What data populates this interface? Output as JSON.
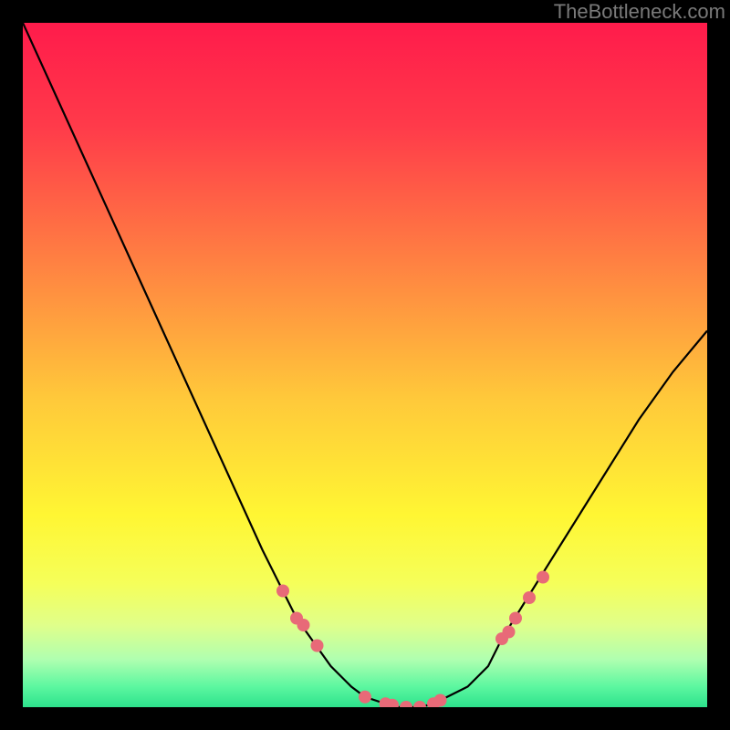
{
  "watermark": "TheBottleneck.com",
  "chart_data": {
    "type": "line",
    "title": "",
    "xlabel": "",
    "ylabel": "",
    "xlim": [
      0,
      100
    ],
    "ylim": [
      0,
      100
    ],
    "curve": {
      "x": [
        0,
        5,
        10,
        15,
        20,
        25,
        30,
        35,
        40,
        45,
        48,
        50,
        53,
        55,
        58,
        60,
        62,
        65,
        68,
        70,
        75,
        80,
        85,
        90,
        95,
        100
      ],
      "y": [
        100,
        89,
        78,
        67,
        56,
        45,
        34,
        23,
        13,
        6,
        3,
        1.5,
        0.5,
        0,
        0,
        0.5,
        1.5,
        3,
        6,
        10,
        18,
        26,
        34,
        42,
        49,
        55
      ]
    },
    "markers": {
      "x": [
        38,
        40,
        41,
        43,
        50,
        53,
        54,
        56,
        58,
        60,
        61,
        70,
        71,
        72,
        74,
        76
      ],
      "y": [
        17,
        13,
        12,
        9,
        1.5,
        0.5,
        0.3,
        0,
        0,
        0.5,
        1,
        10,
        11,
        13,
        16,
        19
      ]
    },
    "gradient_stops": [
      {
        "offset": 0.0,
        "color": "#ff1b4b"
      },
      {
        "offset": 0.15,
        "color": "#ff3a4a"
      },
      {
        "offset": 0.35,
        "color": "#ff8142"
      },
      {
        "offset": 0.55,
        "color": "#ffc93a"
      },
      {
        "offset": 0.72,
        "color": "#fff633"
      },
      {
        "offset": 0.82,
        "color": "#f5ff5a"
      },
      {
        "offset": 0.88,
        "color": "#e0ff8a"
      },
      {
        "offset": 0.93,
        "color": "#b0ffb0"
      },
      {
        "offset": 0.97,
        "color": "#5cf7a0"
      },
      {
        "offset": 1.0,
        "color": "#2de28c"
      }
    ],
    "marker_color": "#e86a78",
    "line_color": "#000000",
    "background": "#000000"
  }
}
